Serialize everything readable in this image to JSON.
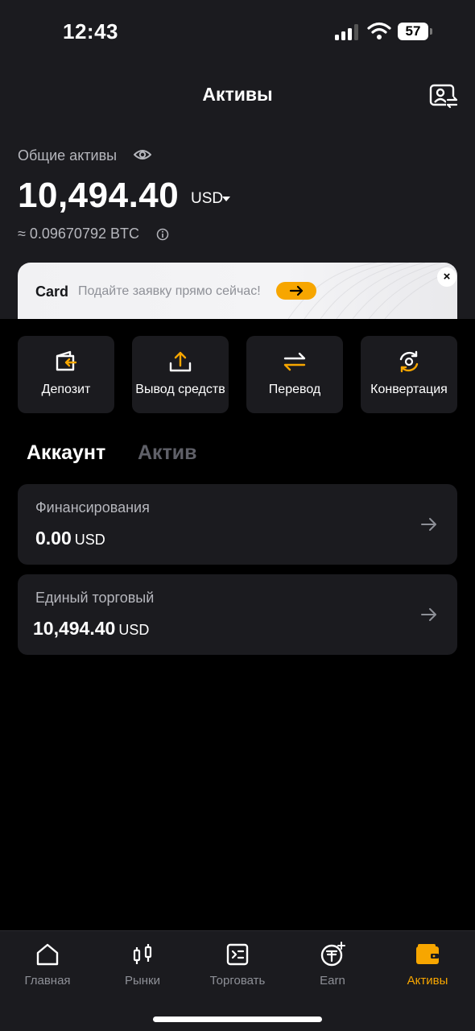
{
  "status_bar": {
    "time": "12:43",
    "battery": "57"
  },
  "header": {
    "title": "Активы",
    "profile_icon": "profile-switch-icon"
  },
  "summary": {
    "label": "Общие активы",
    "value": "10,494.40",
    "currency": "USD",
    "btc_value": "≈ 0.09670792 BTC"
  },
  "promo": {
    "title": "Card",
    "subtitle": "Подайте заявку прямо сейчас!",
    "close": "×"
  },
  "actions": [
    {
      "label": "Депозит",
      "icon": "deposit-icon"
    },
    {
      "label": "Вывод средств",
      "icon": "withdraw-icon"
    },
    {
      "label": "Перевод",
      "icon": "transfer-icon"
    },
    {
      "label": "Конвертация",
      "icon": "convert-icon"
    }
  ],
  "tabs": [
    {
      "label": "Аккаунт",
      "active": true
    },
    {
      "label": "Актив",
      "active": false
    }
  ],
  "accounts": [
    {
      "name": "Финансирования",
      "amount": "0.00",
      "currency": "USD"
    },
    {
      "name": "Единый торговый",
      "amount": "10,494.40",
      "currency": "USD"
    }
  ],
  "bottom_nav": [
    {
      "label": "Главная",
      "icon": "home-icon",
      "active": false
    },
    {
      "label": "Рынки",
      "icon": "candlestick-icon",
      "active": false
    },
    {
      "label": "Торговать",
      "icon": "trade-icon",
      "active": false
    },
    {
      "label": "Earn",
      "icon": "earn-icon",
      "active": false
    },
    {
      "label": "Активы",
      "icon": "wallet-icon",
      "active": true
    }
  ],
  "colors": {
    "accent": "#f7a600",
    "background": "#000000",
    "surface": "#1b1b1f",
    "muted_text": "#b6b7bd"
  }
}
